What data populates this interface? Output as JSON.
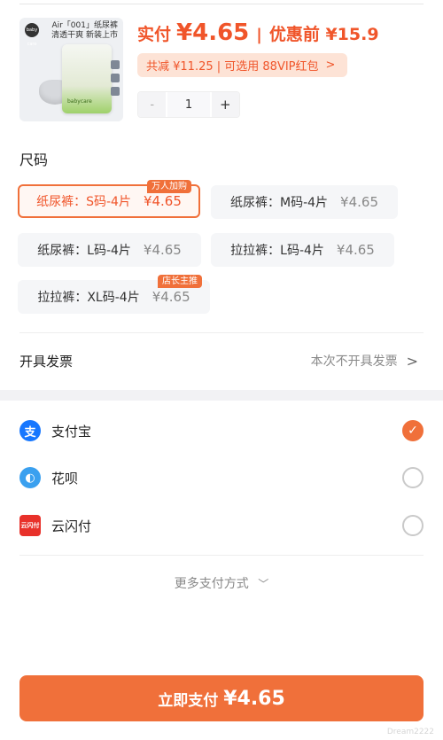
{
  "product": {
    "image_brand": "baby care",
    "image_title_1": "Air「001」纸尿裤",
    "image_title_2": "清透干爽 新装上市",
    "image_pack_text": "babycare",
    "price_label": "实付",
    "price_amount": "¥4.65",
    "price_separator": "|",
    "original_price": "优惠前 ¥15.9",
    "discount_text": "共减 ¥11.25 | 可选用 88VIP红包",
    "quantity": "1",
    "minus_symbol": "-",
    "plus_symbol": "+"
  },
  "size_section": {
    "title": "尺码",
    "options": [
      {
        "label": "纸尿裤：S码-4片",
        "price": "¥4.65",
        "badge": "万人加购",
        "selected": true
      },
      {
        "label": "纸尿裤：M码-4片",
        "price": "¥4.65",
        "badge": "",
        "selected": false
      },
      {
        "label": "纸尿裤：L码-4片",
        "price": "¥4.65",
        "badge": "",
        "selected": false
      },
      {
        "label": "拉拉裤：L码-4片",
        "price": "¥4.65",
        "badge": "",
        "selected": false
      },
      {
        "label": "拉拉裤：XL码-4片",
        "price": "¥4.65",
        "badge": "店长主推",
        "selected": false
      }
    ]
  },
  "invoice": {
    "label": "开具发票",
    "value": "本次不开具发票"
  },
  "payment": {
    "methods": [
      {
        "name": "支付宝",
        "icon": "alipay-icon",
        "icon_glyph": "支",
        "checked": true
      },
      {
        "name": "花呗",
        "icon": "huabei-icon",
        "icon_glyph": "◐",
        "checked": false
      },
      {
        "name": "云闪付",
        "icon": "unionpay-icon",
        "icon_glyph": "云闪付",
        "checked": false
      }
    ],
    "more_label": "更多支付方式"
  },
  "footer": {
    "button_label": "立即支付",
    "button_amount": "¥4.65",
    "watermark": "Dream2222"
  },
  "colors": {
    "accent": "#f0703a",
    "price": "#f0552a",
    "alipay": "#1677ff"
  }
}
